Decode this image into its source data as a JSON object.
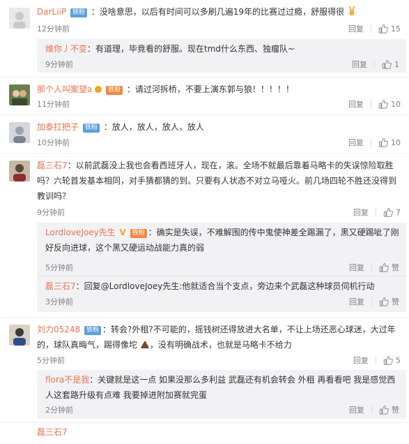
{
  "actions": {
    "reply": "回复",
    "like": "赞"
  },
  "comments": [
    {
      "user": "DarLiiP",
      "badge": "铁粉",
      "text": "：没啥意思，以后有时间可以多刷几遍19年的比赛过过瘾，舒服得很",
      "time": "12分钟前",
      "likes": "15"
    },
    {
      "user": "那个人叫案望a",
      "badge": "铁粉",
      "text": "：请过河拆桥，不要上演东郭与狼！！！！！",
      "time": "11分钟前",
      "likes": "10"
    },
    {
      "user": "加泰扛把子",
      "badge": "铁粉",
      "text": "：放人，放人，放人，放人",
      "time": "10分钟前",
      "likes": "10"
    },
    {
      "user": "磊三石7",
      "text": "：以前武磊没上我也会看西班牙人，现在，滚。全场不就最后靠着马略卡的失误惊险取胜吗？六轮首发基本相同，对手猜都猜的到。只要有人状态不对立马哑火。前几场四轮不胜还没得到教训吗？",
      "time": "9分钟前",
      "likes": "7"
    },
    {
      "user": "刘力05248",
      "badge": "铁粉",
      "text": "：转会?外租?不可能的，摇钱树还得放进大名单，不让上场还恶心球迷，大过年的，球队真晦气，踢得像坨",
      "text2": "，没有明确战术，也就是马略卡不给力",
      "time": "5分钟前",
      "likes": "5"
    }
  ],
  "replies": {
    "c1": {
      "user": "维你丿不变",
      "text": "：有道理，毕竟看的舒服。现在tmd什么东西、独瘤队~",
      "time": "9分钟前",
      "likes": "1"
    },
    "c4a": {
      "user": "LordloveJoey先生",
      "badge": "铁粉",
      "text": "：确实是失误，不难解围的传中鬼使神差全踢漏了，黑又硬踢呲了刚好反向进球，这个黑又硬运动战能力真的弱",
      "time": "5分钟前"
    },
    "c4b": {
      "user": "磊三石7",
      "text": "：回复@LordloveJoey先生:他就适合当个支点，旁边来个武磊这种球员伺机行动",
      "time": "3分钟前"
    },
    "c5": {
      "user": "flora不是我",
      "text": "：关键就是这一点 如果没那么多利益 武磊还有机会转会 外租 再看看吧 我是感觉西人这套路升级有点难 我要掉进附加赛就完蛋",
      "time": "2分钟前"
    }
  },
  "truncated_user": "磊三石7"
}
